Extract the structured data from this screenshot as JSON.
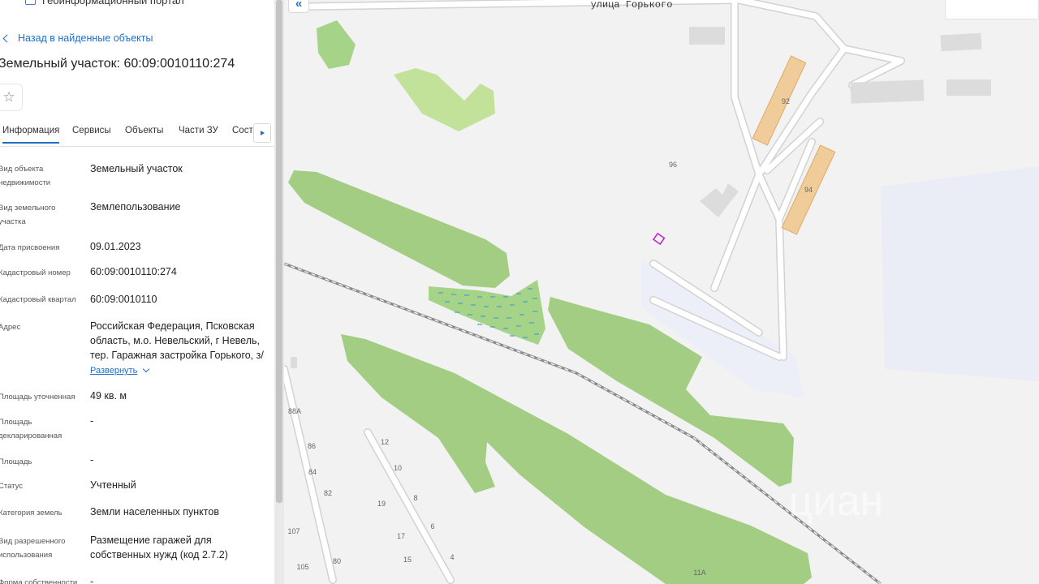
{
  "header": {
    "title": "Геоинформационный портал"
  },
  "panel": {
    "back_label": "Назад в найденные объекты",
    "title": "Земельный участок: 60:09:0010110:274",
    "tabs": [
      "Информация",
      "Сервисы",
      "Объекты",
      "Части ЗУ",
      "Соста"
    ],
    "active_tab": "Информация",
    "fields": [
      {
        "label": "Вид объекта недвижимости",
        "value": "Земельный участок"
      },
      {
        "label": "Вид земельного участка",
        "value": "Землепользование"
      },
      {
        "label": "Дата присвоения",
        "value": "09.01.2023"
      },
      {
        "label": "Кадастровый номер",
        "value": "60:09:0010110:274"
      },
      {
        "label": "Кадастровый квартал",
        "value": "60:09:0010110"
      },
      {
        "label": "Адрес",
        "value": "Российская Федерация, Псковская область, м.о. Невельский, г Невель, тер. Гаражная застройка Горького, з/"
      },
      {
        "label": "Площадь уточненная",
        "value": "49 кв. м"
      },
      {
        "label": "Площадь декларированная",
        "value": "-"
      },
      {
        "label": "Площадь",
        "value": "-"
      },
      {
        "label": "Статус",
        "value": "Учтенный"
      },
      {
        "label": "Категория земель",
        "value": "Земли населенных пунктов"
      },
      {
        "label": "Вид разрешенного использования",
        "value": "Размещение гаражей для собственных нужд (код 2.7.2)"
      },
      {
        "label": "Форма собственности",
        "value": "-"
      }
    ],
    "expand_label": "Развернуть"
  },
  "map": {
    "street_label": "улица Горького",
    "house_numbers": [
      "92",
      "94",
      "96",
      "88А",
      "86",
      "84",
      "82",
      "107",
      "105",
      "80",
      "12",
      "10",
      "8",
      "6",
      "4",
      "19",
      "17",
      "15",
      "11А"
    ],
    "watermark": "циан",
    "colors": {
      "background": "#f2f2f2",
      "forest": "#a3cd83",
      "forest_light": "#c2e29a",
      "building": "#dcdcdc",
      "highlight_building": "#f0cc9a",
      "railway": "#8a8a8a",
      "selected_parcel": "#c02bd0",
      "accent": "#1f6fc5"
    }
  }
}
